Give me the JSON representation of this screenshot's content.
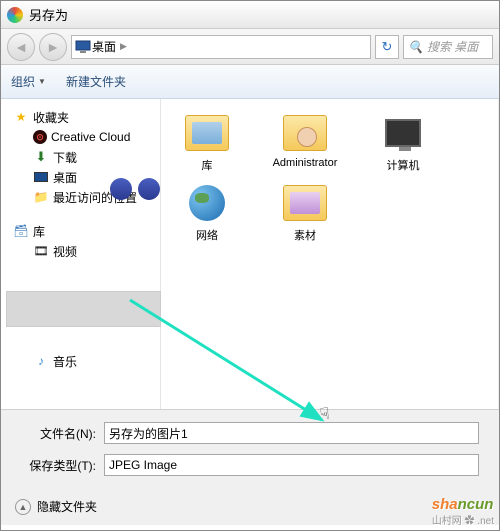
{
  "title": "另存为",
  "breadcrumb": {
    "location": "桌面"
  },
  "search": {
    "placeholder": "搜索 桌面"
  },
  "toolbar": {
    "organize": "组织",
    "new_folder": "新建文件夹"
  },
  "sidebar": {
    "favorites": "收藏夹",
    "fav_items": [
      {
        "label": "Creative Cloud"
      },
      {
        "label": "下载"
      },
      {
        "label": "桌面"
      },
      {
        "label": "最近访问的位置"
      }
    ],
    "libraries": "库",
    "lib_items": [
      {
        "label": "视频"
      }
    ],
    "music": "音乐"
  },
  "content": {
    "items": [
      {
        "label": "库",
        "type": "library"
      },
      {
        "label": "Administrator",
        "type": "user"
      },
      {
        "label": "计算机",
        "type": "computer"
      },
      {
        "label": "网络",
        "type": "network"
      },
      {
        "label": "素材",
        "type": "pics"
      }
    ]
  },
  "fields": {
    "filename_label": "文件名(N):",
    "filename_value": "另存为的图片1",
    "filetype_label": "保存类型(T):",
    "filetype_value": "JPEG Image"
  },
  "hide_folders": "隐藏文件夹",
  "watermark": {
    "main_a": "sha",
    "main_b": "ncun",
    "sub": "山村网 ✿ .net"
  }
}
